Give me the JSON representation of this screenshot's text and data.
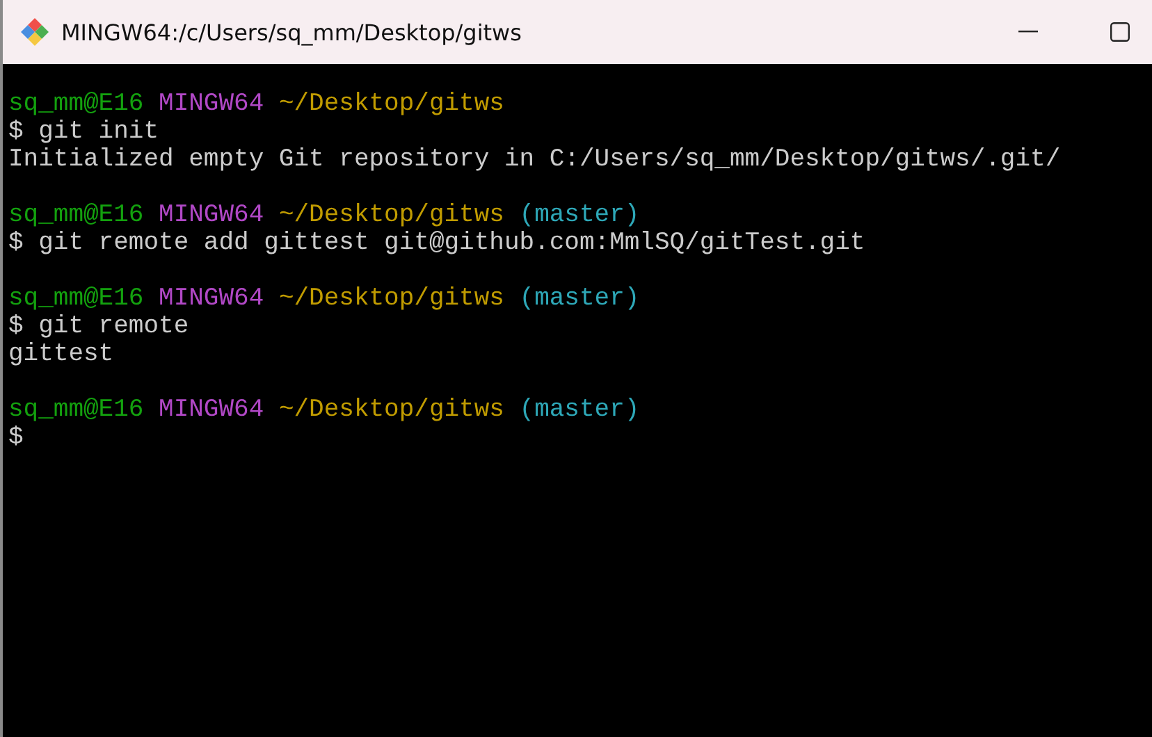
{
  "window": {
    "title": "MINGW64:/c/Users/sq_mm/Desktop/gitws"
  },
  "terminal": {
    "blocks": [
      {
        "prompt": {
          "user": "sq_mm@E16",
          "host": "MINGW64",
          "path": "~/Desktop/gitws"
        },
        "command": "$ git init",
        "output": [
          "Initialized empty Git repository in C:/Users/sq_mm/Desktop/gitws/.git/"
        ]
      },
      {
        "prompt": {
          "user": "sq_mm@E16",
          "host": "MINGW64",
          "path": "~/Desktop/gitws",
          "branch": "(master)"
        },
        "command": "$ git remote add gittest git@github.com:MmlSQ/gitTest.git"
      },
      {
        "prompt": {
          "user": "sq_mm@E16",
          "host": "MINGW64",
          "path": "~/Desktop/gitws",
          "branch": "(master)"
        },
        "command": "$ git remote",
        "output": [
          "gittest"
        ]
      },
      {
        "prompt": {
          "user": "sq_mm@E16",
          "host": "MINGW64",
          "path": "~/Desktop/gitws",
          "branch": "(master)"
        },
        "command": "$"
      }
    ]
  }
}
